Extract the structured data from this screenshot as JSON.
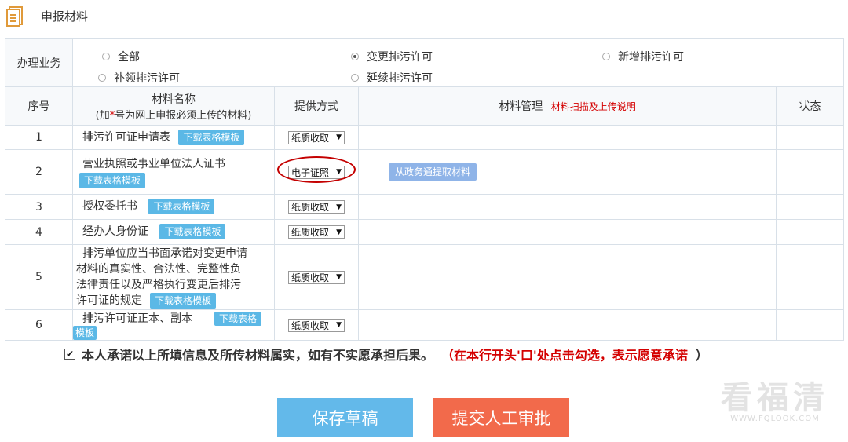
{
  "header": {
    "title": "申报材料",
    "icon": "document-icon"
  },
  "business": {
    "label": "办理业务",
    "options": [
      {
        "label": "全部",
        "checked": false
      },
      {
        "label": "变更排污许可",
        "checked": true
      },
      {
        "label": "新增排污许可",
        "checked": false
      },
      {
        "label": "补领排污许可",
        "checked": false
      },
      {
        "label": "延续排污许可",
        "checked": false
      }
    ]
  },
  "table": {
    "headers": {
      "index": "序号",
      "name_line1": "材料名称",
      "name_line2_prefix": "(加",
      "name_line2_star": "*",
      "name_line2_suffix": "号为网上申报必须上传的材料)",
      "method": "提供方式",
      "manage": "材料管理",
      "manage_link": "材料扫描及上传说明",
      "status": "状态"
    },
    "template_btn": "下载表格模板",
    "template_btn_part1": "下载表格",
    "template_btn_part2": "模板",
    "rows": [
      {
        "index": "1",
        "name": "排污许可证申请表",
        "method": "纸质收取"
      },
      {
        "index": "2",
        "name": "营业执照或事业单位法人证书",
        "method": "电子证照",
        "action": "从政务通提取材料"
      },
      {
        "index": "3",
        "name": "授权委托书",
        "method": "纸质收取"
      },
      {
        "index": "4",
        "name": "经办人身份证",
        "method": "纸质收取"
      },
      {
        "index": "5",
        "name_l1": "排污单位应当书面承诺对变更申请",
        "name_l2": "材料的真实性、合法性、完整性负",
        "name_l3": "法律责任以及严格执行变更后排污",
        "name_l4": "许可证的规定",
        "method": "纸质收取"
      },
      {
        "index": "6",
        "name": "排污许可证正本、副本",
        "method": "纸质收取"
      }
    ]
  },
  "pledge": {
    "text": "本人承诺以上所填信息及所传材料属实，如有不实愿承担后果。",
    "open": "（",
    "hint": "在本行开头'口'处点击勾选，表示愿意承诺",
    "close": "）",
    "checked": true
  },
  "buttons": {
    "save": "保存草稿",
    "submit": "提交人工审批"
  },
  "watermark": {
    "big": "看福清",
    "small": "WWW.FQLOOK.COM"
  },
  "colors": {
    "template_btn": "#5bb8e6",
    "save": "#63b9ea",
    "submit": "#f26a4b",
    "hint_red": "#d40000"
  }
}
